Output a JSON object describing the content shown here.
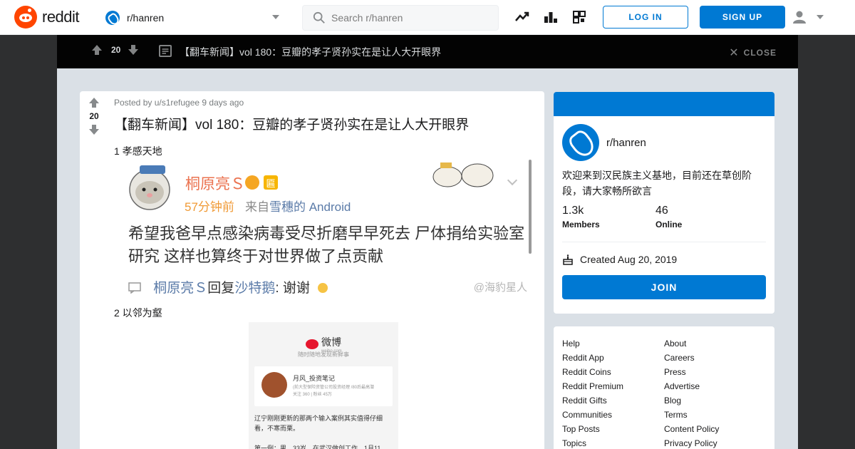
{
  "header": {
    "logo_text": "reddit",
    "community": "r/hanren",
    "search_placeholder": "Search r/hanren",
    "login_label": "LOG IN",
    "signup_label": "SIGN UP"
  },
  "post_bar": {
    "score": "20",
    "title": "【翻车新闻】vol 180：豆瓣的孝子贤孙实在是让人大开眼界",
    "close_label": "CLOSE"
  },
  "post": {
    "score": "20",
    "meta": "Posted by u/s1refugee 9 days ago",
    "title": "【翻车新闻】vol 180：豆瓣的孝子贤孙实在是让人大开眼界",
    "section1": "1 孝感天地",
    "section2": "2 以邻为壑",
    "image1": {
      "username": "桐原亮Ｓ",
      "vip": "匾",
      "time": "57分钟前",
      "source_prefix": "来自",
      "source_device": "雪穗的 Android",
      "body": "希望我爸早点感染病毒受尽折磨早早死去 尸体捐给实验室研究 这样也算终于对世界做了点贡献",
      "reply_user": "桐原亮Ｓ",
      "reply_word": "回复",
      "reply_target": "沙特鹅",
      "reply_text": ": 谢谢",
      "watermark": "@海豹星人"
    },
    "image2": {
      "brand": "微博",
      "brand_sub": "weibo.com",
      "tagline": "随时随地发现新鲜事",
      "card_name": "月风_投资笔记",
      "card_desc": "(前大型保险资管公司投资经理 /80后最高潜",
      "card_stats": "关注 360 | 粉丝 45万",
      "text1": "辽宁刚刚更新的那两个输入案例其实值得仔细看，不寒而栗。",
      "text2": "第一例：男，33岁，在武汉做创工作，1月11"
    }
  },
  "sidebar": {
    "name": "r/hanren",
    "description": "欢迎来到汉民族主义基地，目前还在草创阶段，请大家畅所欲言",
    "members_value": "1.3k",
    "members_label": "Members",
    "online_value": "46",
    "online_label": "Online",
    "created": "Created Aug 20, 2019",
    "join_label": "JOIN"
  },
  "footer_links": {
    "col1": [
      "Help",
      "Reddit App",
      "Reddit Coins",
      "Reddit Premium",
      "Reddit Gifts",
      "Communities",
      "Top Posts",
      "Topics"
    ],
    "col2": [
      "About",
      "Careers",
      "Press",
      "Advertise",
      "Blog",
      "Terms",
      "Content Policy",
      "Privacy Policy"
    ]
  },
  "colors": {
    "brand": "#ff4500",
    "accent": "#0079d3",
    "overlay": "#2e2f30",
    "content_bg": "#dae0e6"
  }
}
